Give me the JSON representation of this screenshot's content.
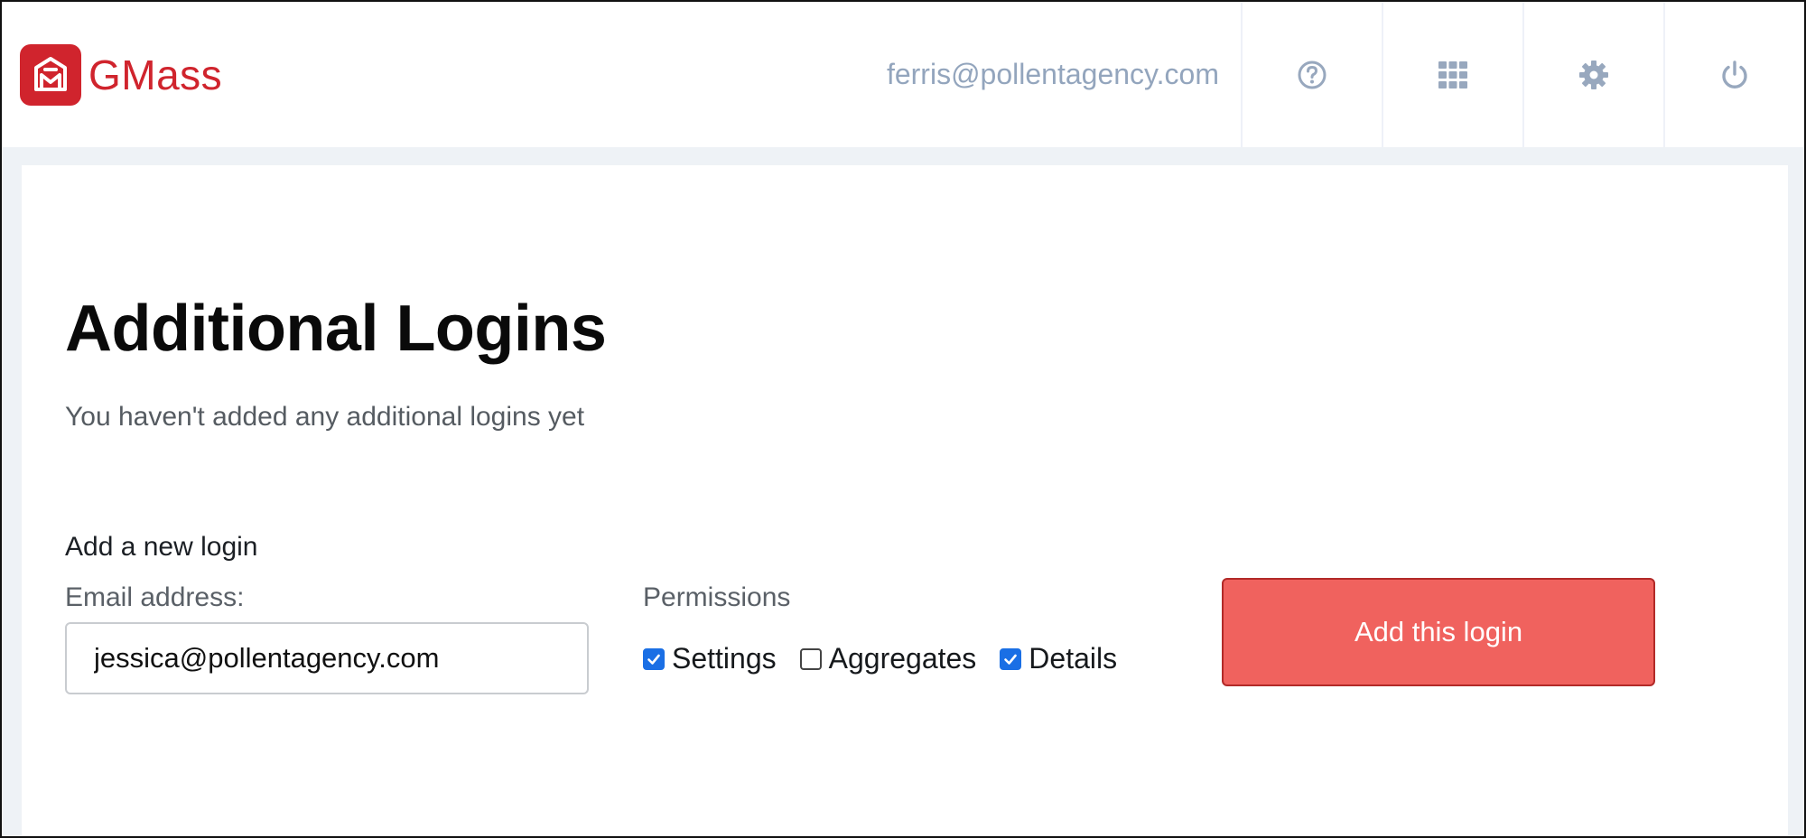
{
  "app": {
    "brand_name": "GMass",
    "brand_color": "#d0242d"
  },
  "header": {
    "user_email": "ferris@pollentagency.com",
    "icons": [
      "help-icon",
      "apps-grid-icon",
      "settings-gear-icon",
      "power-icon"
    ]
  },
  "main": {
    "title": "Additional Logins",
    "empty_message": "You haven't added any additional logins yet",
    "form": {
      "section_label": "Add a new login",
      "email_label": "Email address:",
      "email_value": "jessica@pollentagency.com",
      "permissions_label": "Permissions",
      "permissions": [
        {
          "label": "Settings",
          "checked": true
        },
        {
          "label": "Aggregates",
          "checked": false
        },
        {
          "label": "Details",
          "checked": true
        }
      ],
      "submit_label": "Add this login",
      "submit_color": "#f0625e"
    }
  }
}
